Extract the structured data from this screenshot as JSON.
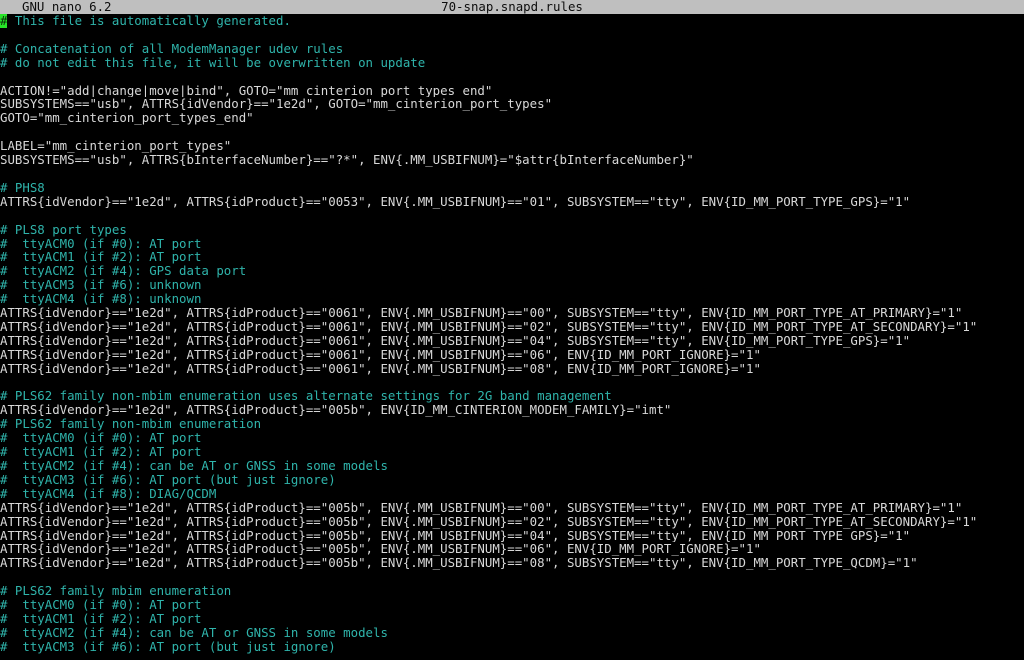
{
  "titlebar": {
    "editor_name": "GNU nano 6.2",
    "filename": "70-snap.snapd.rules"
  },
  "editor": {
    "cursor": {
      "line": 0,
      "column": 0,
      "char": "#",
      "bg_color": "#27e327",
      "fg_color": "#0a2f0a"
    },
    "colors": {
      "comment": "#2fb4ab",
      "code": "#d8d8d8",
      "background": "#000000",
      "titlebar_bg": "#bfbfbf",
      "titlebar_fg": "#0d0d0d"
    },
    "lines": [
      {
        "type": "comment",
        "text": "# This file is automatically generated."
      },
      {
        "type": "blank",
        "text": ""
      },
      {
        "type": "comment",
        "text": "# Concatenation of all ModemManager udev rules"
      },
      {
        "type": "comment",
        "text": "# do not edit this file, it will be overwritten on update"
      },
      {
        "type": "blank",
        "text": ""
      },
      {
        "type": "code",
        "text": "ACTION!=\"add|change|move|bind\", GOTO=\"mm_cinterion_port_types_end\""
      },
      {
        "type": "code",
        "text": "SUBSYSTEMS==\"usb\", ATTRS{idVendor}==\"1e2d\", GOTO=\"mm_cinterion_port_types\""
      },
      {
        "type": "code",
        "text": "GOTO=\"mm_cinterion_port_types_end\""
      },
      {
        "type": "blank",
        "text": ""
      },
      {
        "type": "code",
        "text": "LABEL=\"mm_cinterion_port_types\""
      },
      {
        "type": "code",
        "text": "SUBSYSTEMS==\"usb\", ATTRS{bInterfaceNumber}==\"?*\", ENV{.MM_USBIFNUM}=\"$attr{bInterfaceNumber}\""
      },
      {
        "type": "blank",
        "text": ""
      },
      {
        "type": "comment",
        "text": "# PHS8"
      },
      {
        "type": "code",
        "text": "ATTRS{idVendor}==\"1e2d\", ATTRS{idProduct}==\"0053\", ENV{.MM_USBIFNUM}==\"01\", SUBSYSTEM==\"tty\", ENV{ID_MM_PORT_TYPE_GPS}=\"1\""
      },
      {
        "type": "blank",
        "text": ""
      },
      {
        "type": "comment",
        "text": "# PLS8 port types"
      },
      {
        "type": "comment",
        "text": "#  ttyACM0 (if #0): AT port"
      },
      {
        "type": "comment",
        "text": "#  ttyACM1 (if #2): AT port"
      },
      {
        "type": "comment",
        "text": "#  ttyACM2 (if #4): GPS data port"
      },
      {
        "type": "comment",
        "text": "#  ttyACM3 (if #6): unknown"
      },
      {
        "type": "comment",
        "text": "#  ttyACM4 (if #8): unknown"
      },
      {
        "type": "code",
        "text": "ATTRS{idVendor}==\"1e2d\", ATTRS{idProduct}==\"0061\", ENV{.MM_USBIFNUM}==\"00\", SUBSYSTEM==\"tty\", ENV{ID_MM_PORT_TYPE_AT_PRIMARY}=\"1\""
      },
      {
        "type": "code",
        "text": "ATTRS{idVendor}==\"1e2d\", ATTRS{idProduct}==\"0061\", ENV{.MM_USBIFNUM}==\"02\", SUBSYSTEM==\"tty\", ENV{ID_MM_PORT_TYPE_AT_SECONDARY}=\"1\""
      },
      {
        "type": "code",
        "text": "ATTRS{idVendor}==\"1e2d\", ATTRS{idProduct}==\"0061\", ENV{.MM_USBIFNUM}==\"04\", SUBSYSTEM==\"tty\", ENV{ID_MM_PORT_TYPE_GPS}=\"1\""
      },
      {
        "type": "code",
        "text": "ATTRS{idVendor}==\"1e2d\", ATTRS{idProduct}==\"0061\", ENV{.MM_USBIFNUM}==\"06\", ENV{ID_MM_PORT_IGNORE}=\"1\""
      },
      {
        "type": "code",
        "text": "ATTRS{idVendor}==\"1e2d\", ATTRS{idProduct}==\"0061\", ENV{.MM_USBIFNUM}==\"08\", ENV{ID_MM_PORT_IGNORE}=\"1\""
      },
      {
        "type": "blank",
        "text": ""
      },
      {
        "type": "comment",
        "text": "# PLS62 family non-mbim enumeration uses alternate settings for 2G band management"
      },
      {
        "type": "code",
        "text": "ATTRS{idVendor}==\"1e2d\", ATTRS{idProduct}==\"005b\", ENV{ID_MM_CINTERION_MODEM_FAMILY}=\"imt\""
      },
      {
        "type": "comment",
        "text": "# PLS62 family non-mbim enumeration"
      },
      {
        "type": "comment",
        "text": "#  ttyACM0 (if #0): AT port"
      },
      {
        "type": "comment",
        "text": "#  ttyACM1 (if #2): AT port"
      },
      {
        "type": "comment",
        "text": "#  ttyACM2 (if #4): can be AT or GNSS in some models"
      },
      {
        "type": "comment",
        "text": "#  ttyACM3 (if #6): AT port (but just ignore)"
      },
      {
        "type": "comment",
        "text": "#  ttyACM4 (if #8): DIAG/QCDM"
      },
      {
        "type": "code",
        "text": "ATTRS{idVendor}==\"1e2d\", ATTRS{idProduct}==\"005b\", ENV{.MM_USBIFNUM}==\"00\", SUBSYSTEM==\"tty\", ENV{ID_MM_PORT_TYPE_AT_PRIMARY}=\"1\""
      },
      {
        "type": "code",
        "text": "ATTRS{idVendor}==\"1e2d\", ATTRS{idProduct}==\"005b\", ENV{.MM_USBIFNUM}==\"02\", SUBSYSTEM==\"tty\", ENV{ID_MM_PORT_TYPE_AT_SECONDARY}=\"1\""
      },
      {
        "type": "code",
        "text": "ATTRS{idVendor}==\"1e2d\", ATTRS{idProduct}==\"005b\", ENV{.MM_USBIFNUM}==\"04\", SUBSYSTEM==\"tty\", ENV{ID_MM_PORT_TYPE_GPS}=\"1\""
      },
      {
        "type": "code",
        "text": "ATTRS{idVendor}==\"1e2d\", ATTRS{idProduct}==\"005b\", ENV{.MM_USBIFNUM}==\"06\", ENV{ID_MM_PORT_IGNORE}=\"1\""
      },
      {
        "type": "code",
        "text": "ATTRS{idVendor}==\"1e2d\", ATTRS{idProduct}==\"005b\", ENV{.MM_USBIFNUM}==\"08\", SUBSYSTEM==\"tty\", ENV{ID_MM_PORT_TYPE_QCDM}=\"1\""
      },
      {
        "type": "blank",
        "text": ""
      },
      {
        "type": "comment",
        "text": "# PLS62 family mbim enumeration"
      },
      {
        "type": "comment",
        "text": "#  ttyACM0 (if #0): AT port"
      },
      {
        "type": "comment",
        "text": "#  ttyACM1 (if #2): AT port"
      },
      {
        "type": "comment",
        "text": "#  ttyACM2 (if #4): can be AT or GNSS in some models"
      },
      {
        "type": "comment",
        "text": "#  ttyACM3 (if #6): AT port (but just ignore)"
      }
    ]
  }
}
